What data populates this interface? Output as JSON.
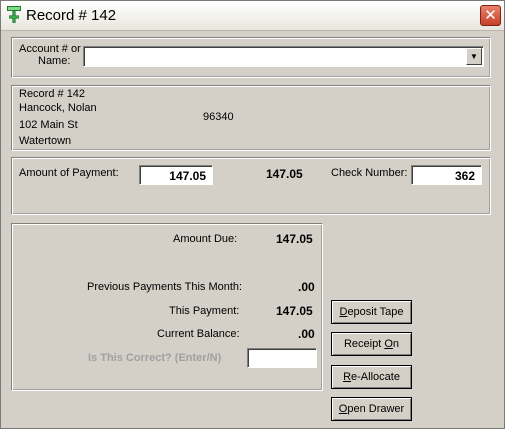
{
  "window": {
    "title": "Record # 142",
    "close_glyph": "✕"
  },
  "account": {
    "label_line1": "Account # or",
    "label_line2": "Name:",
    "value": "",
    "dropdown_glyph": "▼"
  },
  "record": {
    "number": "Record # 142",
    "name": "Hancock, Nolan",
    "street": "102 Main St",
    "city": "Watertown",
    "zip": "96340"
  },
  "payment": {
    "amount_label": "Amount of Payment:",
    "amount_value": "147.05",
    "amount_display": "147.05",
    "check_label": "Check Number:",
    "check_value": "362"
  },
  "summary": {
    "amount_due_label": "Amount Due:",
    "amount_due_value": "147.05",
    "prev_payments_label": "Previous Payments This Month:",
    "prev_payments_value": ".00",
    "this_payment_label": "This Payment:",
    "this_payment_value": "147.05",
    "current_balance_label": "Current Balance:",
    "current_balance_value": ".00",
    "confirm_label": "Is This Correct? (Enter/N)",
    "confirm_value": ""
  },
  "buttons": {
    "deposit_tape": {
      "pre": "",
      "key": "D",
      "post": "eposit Tape"
    },
    "receipt_on": {
      "pre": "Receipt ",
      "key": "O",
      "post": "n"
    },
    "re_allocate": {
      "pre": "",
      "key": "R",
      "post": "e-Allocate"
    },
    "open_drawer": {
      "pre": "",
      "key": "O",
      "post": "pen Drawer"
    }
  },
  "colors": {
    "window_bg": "#d4d0c8",
    "close_button": "#c6402a",
    "disabled_text": "#a0a0a0"
  },
  "icons": {
    "title_icon": "record-app-icon"
  }
}
